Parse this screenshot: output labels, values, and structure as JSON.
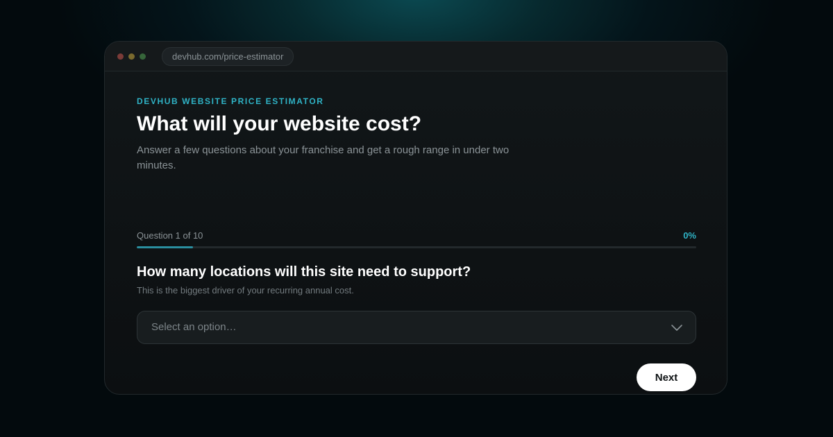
{
  "browser": {
    "url": "devhub.com/price-estimator"
  },
  "estimator": {
    "eyebrow": "DEVHUB WEBSITE PRICE ESTIMATOR",
    "title": "What will your website cost?",
    "subtitle": "Answer a few questions about your franchise and get a rough range in under two minutes.",
    "progress": {
      "label": "Question 1 of 10",
      "percent_text": "0%",
      "current_question": 1,
      "total_questions": 10
    },
    "question": {
      "text": "How many locations will this site need to support?",
      "hint": "This is the biggest driver of your recurring annual cost.",
      "select_placeholder": "Select an option…"
    },
    "next_label": "Next"
  },
  "colors": {
    "accent": "#2fb3c6",
    "background": "#03090c",
    "panel": "#121719",
    "button_bg": "#ffffff"
  },
  "icons": {
    "dropdown": "chevron-down-icon"
  }
}
